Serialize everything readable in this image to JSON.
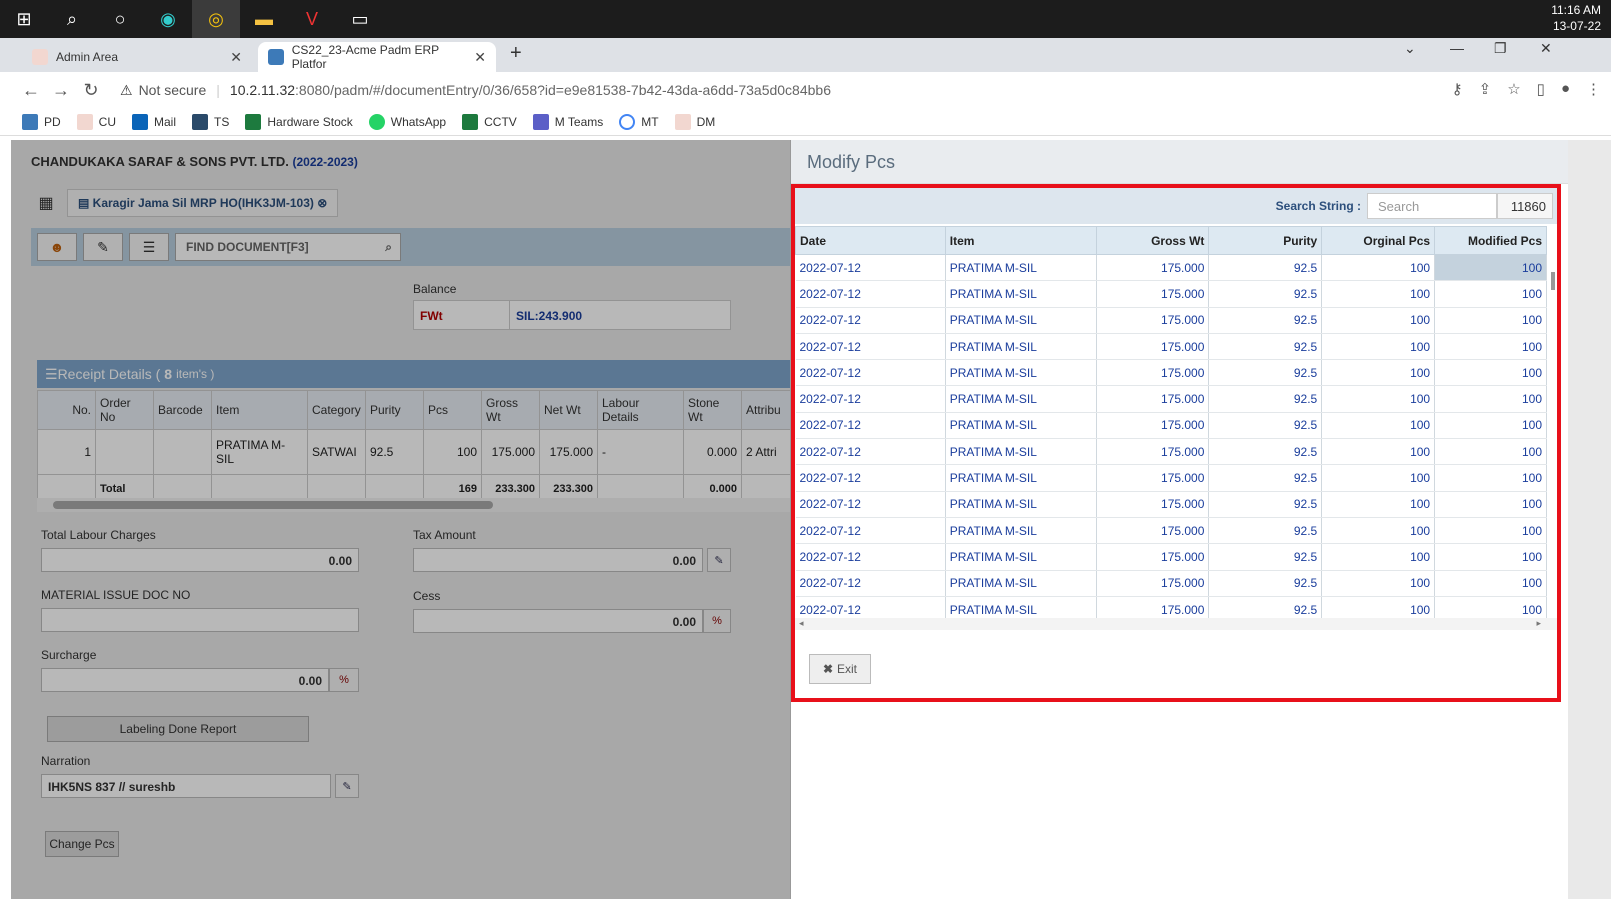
{
  "taskbar": {
    "time": "11:16 AM",
    "date": "13-07-22"
  },
  "browser": {
    "tabs": [
      {
        "label": "Admin Area"
      },
      {
        "label": "CS22_23-Acme Padm ERP Platfor"
      }
    ],
    "security": "Not secure",
    "url_host": "10.2.11.32",
    "url_path": ":8080/padm/#/documentEntry/0/36/658?id=e9e81538-7b42-43da-a6dd-73a5d0c84bb6",
    "bookmarks": [
      "PD",
      "CU",
      "Mail",
      "TS",
      "Hardware Stock",
      "WhatsApp",
      "CCTV",
      "M Teams",
      "MT",
      "DM"
    ]
  },
  "app": {
    "company": "CHANDUKAKA SARAF & SONS PVT. LTD.",
    "year": "(2022-2023)",
    "doc_tab": "Karagir Jama Sil MRP HO(IHK3JM-103)",
    "find_placeholder": "FIND DOCUMENT[F3]",
    "balance_label": "Balance",
    "balance_key": "FWt",
    "balance_value": "SIL:243.900",
    "receipt_title": "Receipt Details (",
    "receipt_count": "8",
    "receipt_suffix": "item's )",
    "receipt_cols": [
      "No.",
      "Order No",
      "Barcode",
      "Item",
      "Category",
      "Purity",
      "Pcs",
      "Gross Wt",
      "Net Wt",
      "Labour Details",
      "Stone Wt",
      "Attribu"
    ],
    "receipt_row": [
      "1",
      "",
      "",
      "PRATIMA M-SIL",
      "SATWAI",
      "92.5",
      "100",
      "175.000",
      "175.000",
      "-",
      "0.000",
      "2 Attri"
    ],
    "receipt_total": [
      "",
      "Total",
      "",
      "",
      "",
      "",
      "169",
      "233.300",
      "233.300",
      "",
      "0.000",
      ""
    ],
    "total_labour_label": "Total Labour Charges",
    "total_labour_value": "0.00",
    "tax_label": "Tax Amount",
    "tax_value": "0.00",
    "mat_issue_label": "MATERIAL ISSUE DOC NO",
    "cess_label": "Cess",
    "cess_value": "0.00",
    "surcharge_label": "Surcharge",
    "surcharge_value": "0.00",
    "percent": "%",
    "labeling_btn": "Labeling Done Report",
    "narration_label": "Narration",
    "narration_value": "IHK5NS 837 // sureshb",
    "change_pcs_btn": "Change Pcs"
  },
  "modal": {
    "title": "Modify Pcs",
    "search_label": "Search String :",
    "search_placeholder": "Search",
    "search_count": "11860",
    "columns": [
      "Date",
      "Item",
      "Gross Wt",
      "Purity",
      "Orginal Pcs",
      "Modified Pcs"
    ],
    "rows": [
      [
        "2022-07-12",
        "PRATIMA M-SIL",
        "175.000",
        "92.5",
        "100",
        "100"
      ],
      [
        "2022-07-12",
        "PRATIMA M-SIL",
        "175.000",
        "92.5",
        "100",
        "100"
      ],
      [
        "2022-07-12",
        "PRATIMA M-SIL",
        "175.000",
        "92.5",
        "100",
        "100"
      ],
      [
        "2022-07-12",
        "PRATIMA M-SIL",
        "175.000",
        "92.5",
        "100",
        "100"
      ],
      [
        "2022-07-12",
        "PRATIMA M-SIL",
        "175.000",
        "92.5",
        "100",
        "100"
      ],
      [
        "2022-07-12",
        "PRATIMA M-SIL",
        "175.000",
        "92.5",
        "100",
        "100"
      ],
      [
        "2022-07-12",
        "PRATIMA M-SIL",
        "175.000",
        "92.5",
        "100",
        "100"
      ],
      [
        "2022-07-12",
        "PRATIMA M-SIL",
        "175.000",
        "92.5",
        "100",
        "100"
      ],
      [
        "2022-07-12",
        "PRATIMA M-SIL",
        "175.000",
        "92.5",
        "100",
        "100"
      ],
      [
        "2022-07-12",
        "PRATIMA M-SIL",
        "175.000",
        "92.5",
        "100",
        "100"
      ],
      [
        "2022-07-12",
        "PRATIMA M-SIL",
        "175.000",
        "92.5",
        "100",
        "100"
      ],
      [
        "2022-07-12",
        "PRATIMA M-SIL",
        "175.000",
        "92.5",
        "100",
        "100"
      ],
      [
        "2022-07-12",
        "PRATIMA M-SIL",
        "175.000",
        "92.5",
        "100",
        "100"
      ],
      [
        "2022-07-12",
        "PRATIMA M-SIL",
        "175.000",
        "92.5",
        "100",
        "100"
      ]
    ],
    "exit_label": "Exit"
  },
  "colors": {
    "accent": "#1a3d9c",
    "highlight": "#e8101a",
    "header_bg": "#7fa6cc"
  }
}
